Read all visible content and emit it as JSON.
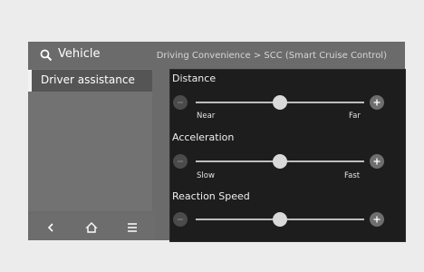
{
  "header": {
    "title": "Vehicle",
    "breadcrumb": "Driving Convenience > SCC (Smart Cruise Control)"
  },
  "sidebar": {
    "items": [
      {
        "label": "Driver assistance",
        "selected": true
      }
    ]
  },
  "bottom_nav": {
    "items": [
      {
        "icon": "chevron-left-icon"
      },
      {
        "icon": "home-icon"
      },
      {
        "icon": "menu-icon"
      }
    ]
  },
  "controls": [
    {
      "label": "Distance",
      "min_label": "Near",
      "max_label": "Far",
      "level": 0.5
    },
    {
      "label": "Acceleration",
      "min_label": "Slow",
      "max_label": "Fast",
      "level": 0.5
    },
    {
      "label": "Reaction Speed",
      "min_label": "",
      "max_label": "",
      "level": 0.5
    }
  ]
}
